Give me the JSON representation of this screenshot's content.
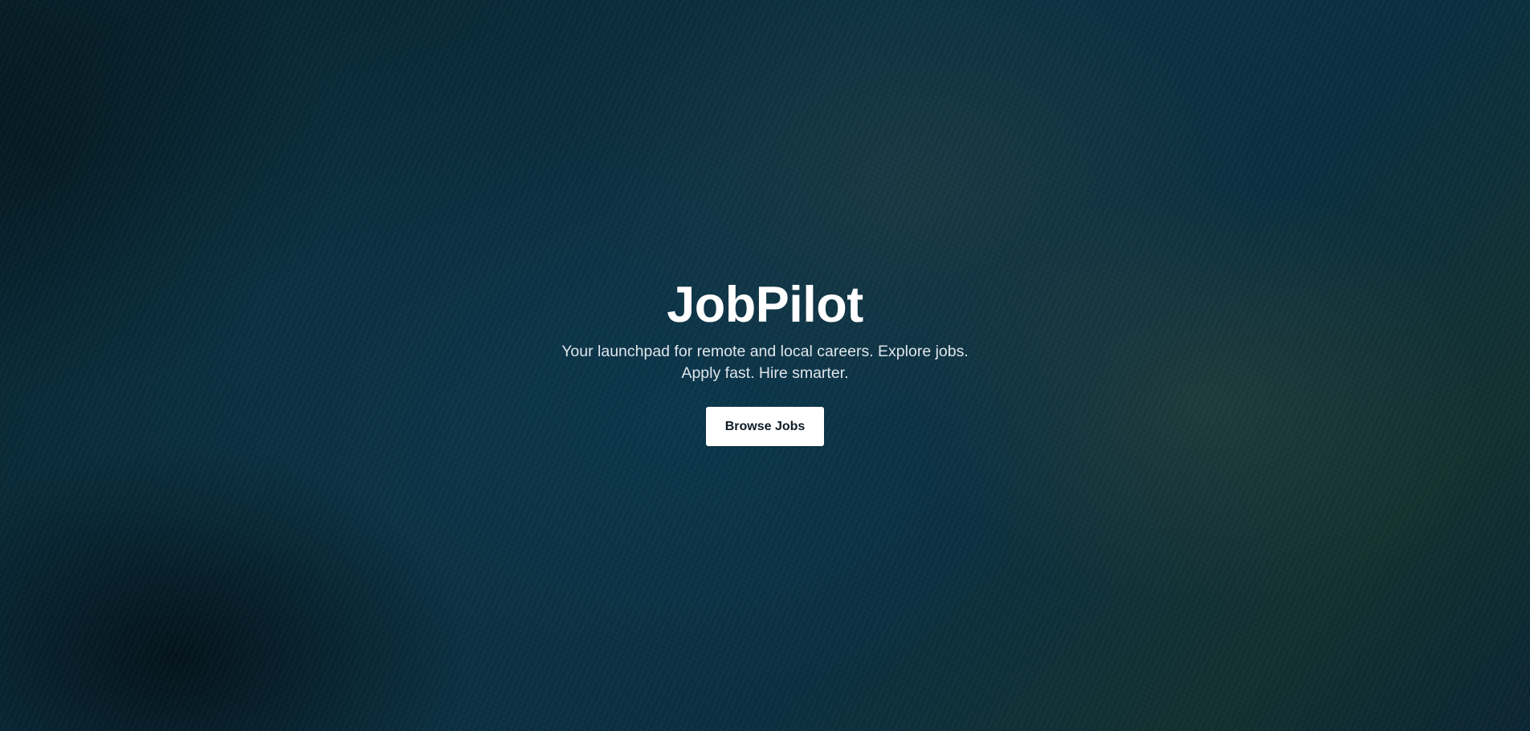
{
  "hero": {
    "title": "JobPilot",
    "subtitle_line1": "Your launchpad for remote and local careers. Explore jobs.",
    "subtitle_line2": "Apply fast. Hire smarter.",
    "cta_label": "Browse Jobs"
  },
  "colors": {
    "background": "#0a2f40",
    "title_text": "#ffffff",
    "subtitle_text": "#dfe6ea",
    "button_bg": "#ffffff",
    "button_text": "#0f1b24"
  }
}
